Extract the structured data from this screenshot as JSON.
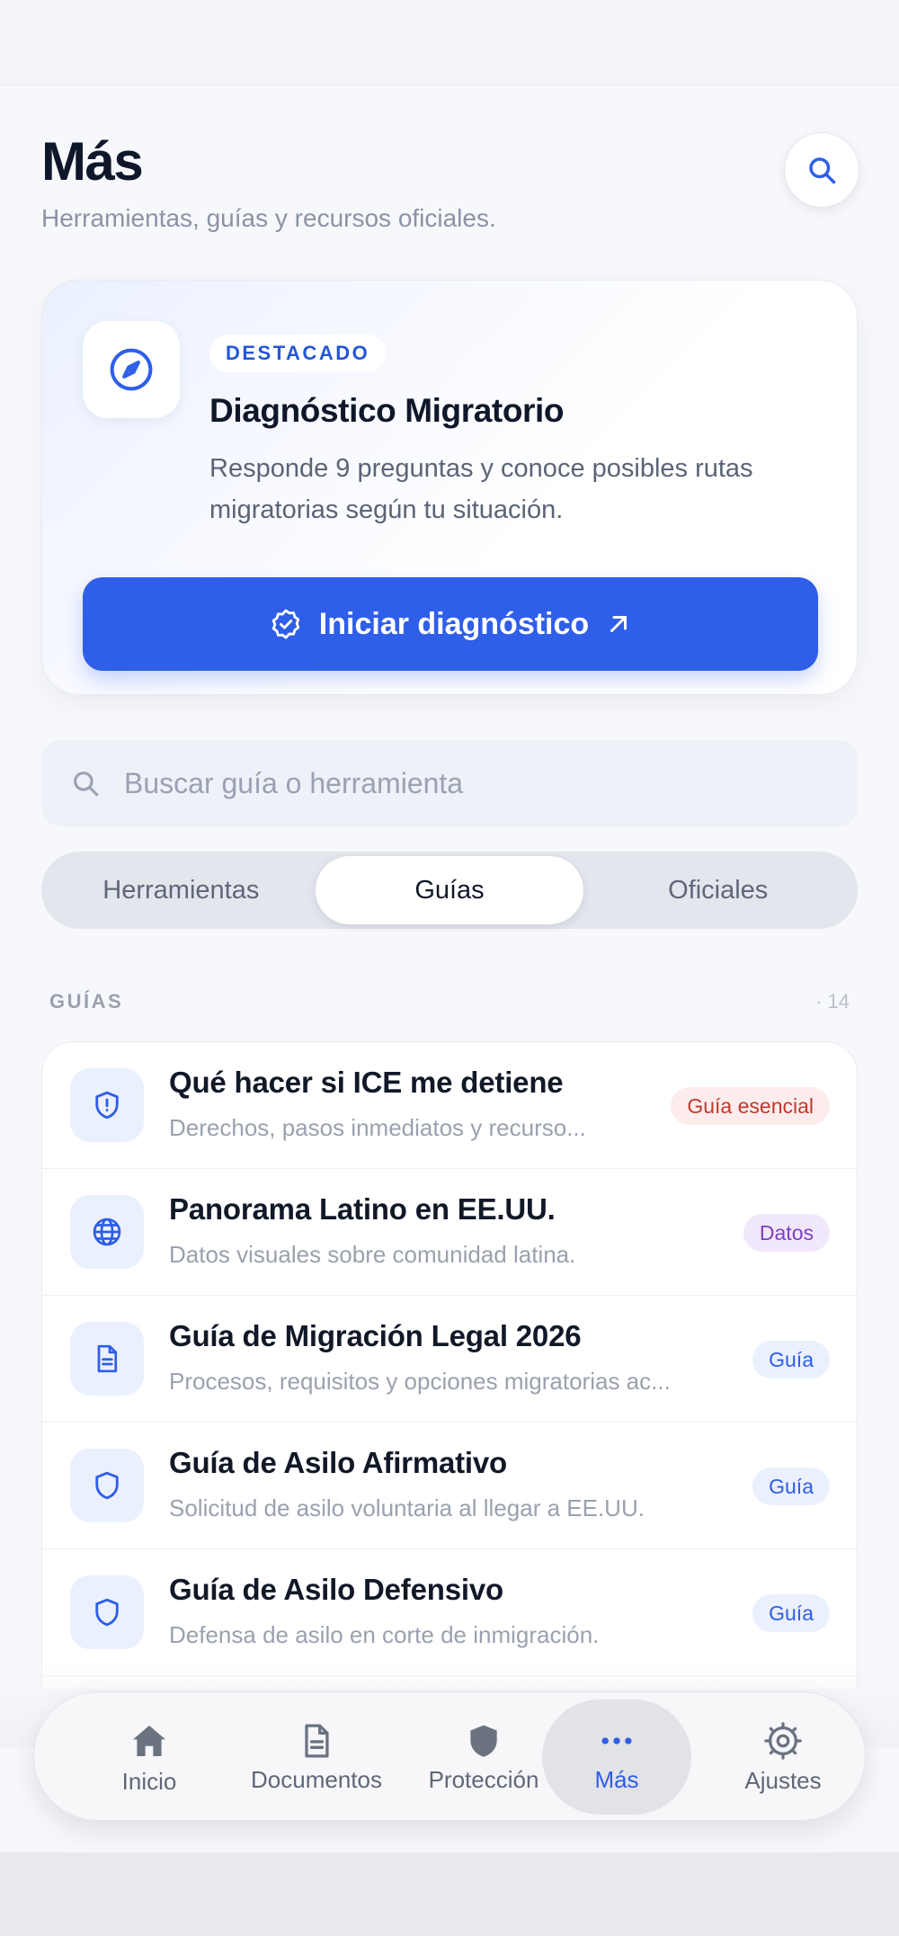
{
  "header": {
    "title": "Más",
    "subtitle": "Herramientas, guías y recursos oficiales.",
    "search_icon": "search-icon"
  },
  "featured": {
    "badge": "DESTACADO",
    "title": "Diagnóstico Migratorio",
    "description": "Responde 9 preguntas y conoce posibles rutas migratorias según tu situación.",
    "icon": "compass-icon",
    "cta_label": "Iniciar diagnóstico",
    "cta_icon": "verified-badge-icon",
    "cta_arrow_icon": "arrow-up-right-icon"
  },
  "search": {
    "placeholder": "Buscar guía o herramienta",
    "value": ""
  },
  "segments": [
    {
      "label": "Herramientas",
      "active": false
    },
    {
      "label": "Guías",
      "active": true
    },
    {
      "label": "Oficiales",
      "active": false
    }
  ],
  "section": {
    "label": "GUÍAS",
    "count": "· 14"
  },
  "guides": [
    {
      "title": "Qué hacer si ICE me detiene",
      "subtitle": "Derechos, pasos inmediatos y recurso...",
      "badge": "Guía esencial",
      "badge_color": "#c0392b",
      "icon": "shield-alert-icon"
    },
    {
      "title": "Panorama Latino en EE.UU.",
      "subtitle": "Datos visuales sobre comunidad latina.",
      "badge": "Datos",
      "badge_color": "#7e3fbf",
      "icon": "globe-icon"
    },
    {
      "title": "Guía de Migración Legal 2026",
      "subtitle": "Procesos, requisitos y opciones migratorias ac...",
      "badge": "Guía",
      "badge_color": "#2f5ee8",
      "icon": "document-icon"
    },
    {
      "title": "Guía de Asilo Afirmativo",
      "subtitle": "Solicitud de asilo voluntaria al llegar a EE.UU.",
      "badge": "Guía",
      "badge_color": "#2f5ee8",
      "icon": "shield-icon"
    },
    {
      "title": "Guía de Asilo Defensivo",
      "subtitle": "Defensa de asilo en corte de inmigración.",
      "badge": "Guía",
      "badge_color": "#2f5ee8",
      "icon": "shield-icon"
    }
  ],
  "tabbar": [
    {
      "label": "Inicio",
      "icon": "home-icon",
      "active": false
    },
    {
      "label": "Documentos",
      "icon": "document-icon",
      "active": false
    },
    {
      "label": "Protección",
      "icon": "shield-icon",
      "active": false
    },
    {
      "label": "Más",
      "icon": "more-dots-icon",
      "active": true
    },
    {
      "label": "Ajustes",
      "icon": "gear-icon",
      "active": false
    }
  ],
  "colors": {
    "accent": "#2f5ee8",
    "background": "#f7f8fb",
    "title": "#0f172a",
    "muted": "#9aa1ae"
  }
}
